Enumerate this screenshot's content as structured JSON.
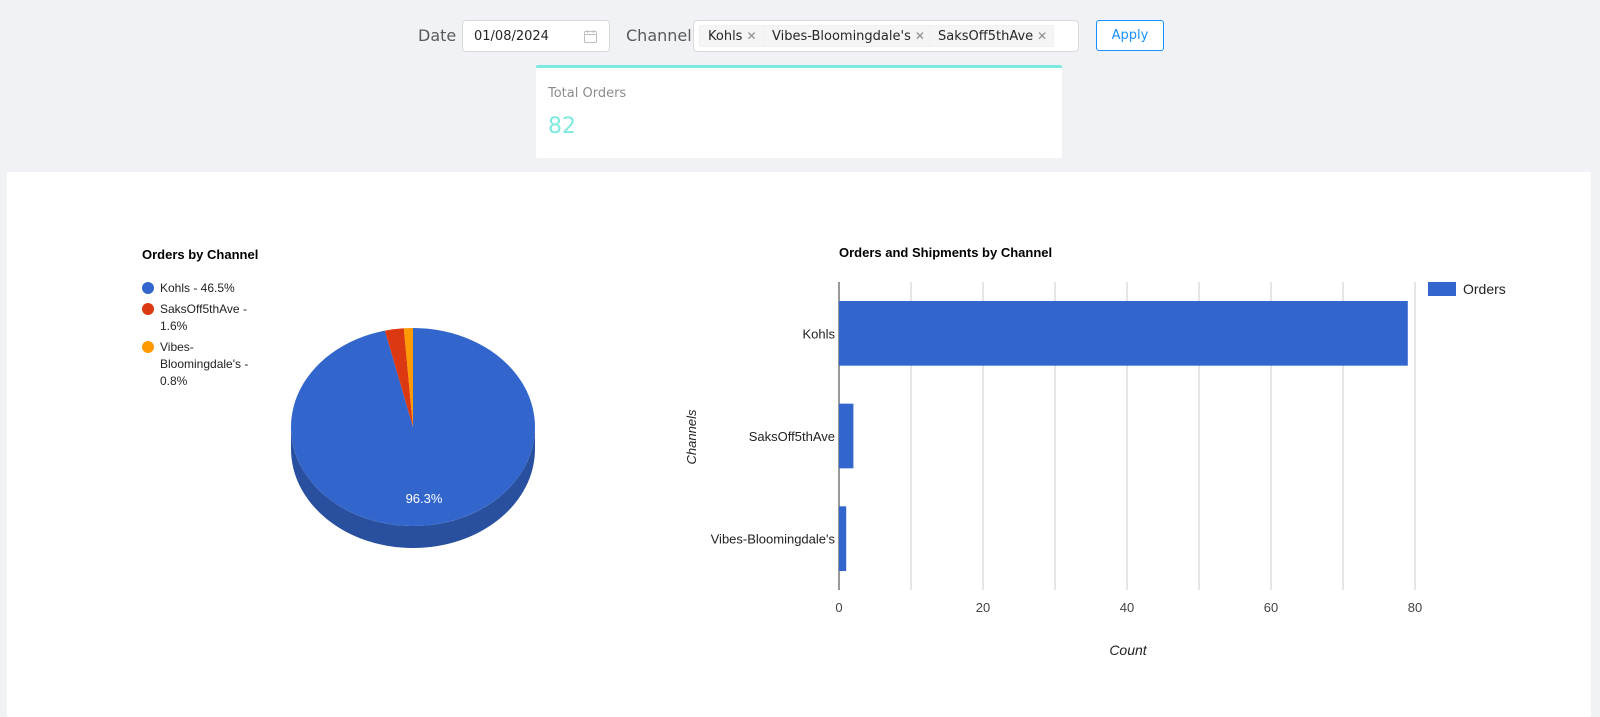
{
  "filters": {
    "date_label": "Date",
    "date_value": "01/08/2024",
    "channel_label": "Channel",
    "channel_tags": [
      "Kohls",
      "Vibes-Bloomingdale's",
      "SaksOff5thAve"
    ],
    "apply_label": "Apply"
  },
  "stat": {
    "title": "Total Orders",
    "value": "82"
  },
  "colors": {
    "blue": "#3366cc",
    "red": "#dc3912",
    "orange": "#ff9900",
    "teal": "#7eeadf",
    "link": "#1890ff"
  },
  "icons": {
    "date": "calendar-icon",
    "tag_remove": "close-icon"
  },
  "chart_data": [
    {
      "type": "pie",
      "title": "Orders by Channel",
      "legend_position": "left",
      "legend": [
        "Kohls - 46.5%",
        "SaksOff5thAve - 1.6%",
        "Vibes-Bloomingdale's - 0.8%"
      ],
      "slices": [
        {
          "label": "Kohls",
          "percent": 96.3,
          "color": "#3366cc"
        },
        {
          "label": "SaksOff5thAve",
          "percent": 2.5,
          "color": "#dc3912"
        },
        {
          "label": "Vibes-Bloomingdale's",
          "percent": 1.2,
          "color": "#ff9900"
        }
      ],
      "slice_label": "96.3%",
      "is3D": true
    },
    {
      "type": "bar",
      "orientation": "horizontal",
      "title": "Orders and Shipments by Channel",
      "categories": [
        "Kohls",
        "SaksOff5thAve",
        "Vibes-Bloomingdale's"
      ],
      "series": [
        {
          "name": "Orders",
          "values": [
            79,
            2,
            1
          ],
          "color": "#3366cc"
        }
      ],
      "xlabel": "Count",
      "ylabel": "Channels",
      "xlim": [
        0,
        80
      ],
      "xticks": [
        "0",
        "20",
        "40",
        "60",
        "80"
      ],
      "grid": true,
      "legend_position": "right"
    }
  ]
}
